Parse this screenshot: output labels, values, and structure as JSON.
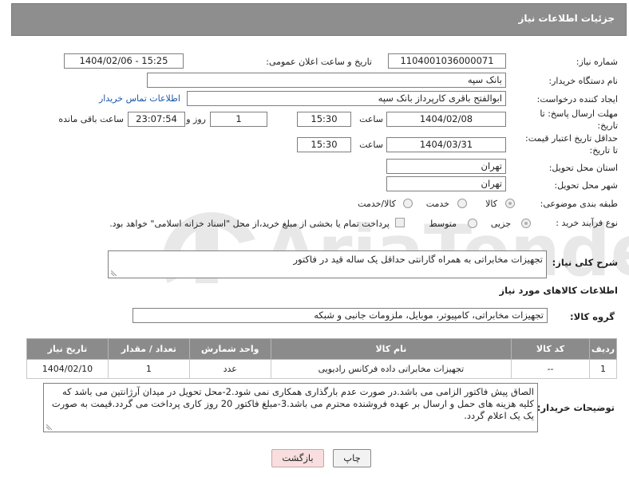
{
  "header": {
    "title": "جزئیات اطلاعات نیاز"
  },
  "form": {
    "need_number_label": "شماره نیاز:",
    "need_number": "1104001036000071",
    "announce_label": "تاریخ و ساعت اعلان عمومی:",
    "announce_value": "1404/02/06 - 15:25",
    "buyer_org_label": "نام دستگاه خریدار:",
    "buyer_org": "بانک سپه",
    "creator_label": "ایجاد کننده درخواست:",
    "creator": "ابوالفتح باقری کارپرداز بانک سپه",
    "contact_link": "اطلاعات تماس خریدار",
    "reply_deadline_label_1": "مهلت ارسال پاسخ: تا",
    "reply_deadline_label_2": "تاریخ:",
    "reply_date": "1404/02/08",
    "time_label": "ساعت",
    "reply_time": "15:30",
    "days_value": "1",
    "days_label": "روز و",
    "remaining_value": "23:07:54",
    "remaining_label": "ساعت باقی مانده",
    "price_validity_label_1": "حداقل تاریخ اعتبار قیمت:",
    "price_validity_label_2": "تا تاریخ:",
    "validity_date": "1404/03/31",
    "validity_time": "15:30",
    "province_label": "استان محل تحویل:",
    "province": "تهران",
    "city_label": "شهر محل تحویل:",
    "city": "تهران",
    "category_label": "طبقه بندی موضوعی:",
    "category_options": [
      "کالا",
      "خدمت",
      "کالا/خدمت"
    ],
    "process_label": "نوع فرآیند خرید :",
    "process_options": [
      "جزیی",
      "متوسط"
    ],
    "payment_note": "پرداخت تمام یا بخشی از مبلغ خرید،از محل \"اسناد خزانه اسلامی\" خواهد بود.",
    "description_label": "شرح کلی نیاز:",
    "description": "تجهیزات مخابراتی به همراه گارانتی حداقل یک ساله قید در فاکتور",
    "goods_info_title": "اطلاعات کالاهای مورد نیاز",
    "goods_group_label": "گروه کالا:",
    "goods_group": "تجهیزات مخابراتی، کامپیوتر، موبایل، ملزومات جانبی و شبکه",
    "buyer_notes_label": "توضیحات خریدار:",
    "buyer_notes": "الصاق پیش فاکتور الزامی می باشد.در صورت عدم بارگذاری همکاری نمی شود.2-محل تحویل در میدان آرژانتین می باشد که کلیه هزینه های حمل و ارسال بر عهده فروشنده محترم می باشد.3-مبلغ فاکتور 20 روز کاری پرداخت می گردد.قیمت به صورت یک یک اعلام گردد."
  },
  "table": {
    "headers": [
      "ردیف",
      "کد کالا",
      "نام کالا",
      "واحد شمارش",
      "تعداد / مقدار",
      "تاریخ نیاز"
    ],
    "rows": [
      [
        "1",
        "--",
        "تجهیزات مخابراتی داده فرکانس رادیویی",
        "عدد",
        "1",
        "1404/02/10"
      ]
    ]
  },
  "buttons": {
    "print": "چاپ",
    "back": "بازگشت"
  },
  "watermark": {
    "text": "AriaTender.neT"
  },
  "colors": {
    "header_bg": "#8e8e8e",
    "link": "#1c56a8",
    "back_button_bg": "#f8dede"
  }
}
